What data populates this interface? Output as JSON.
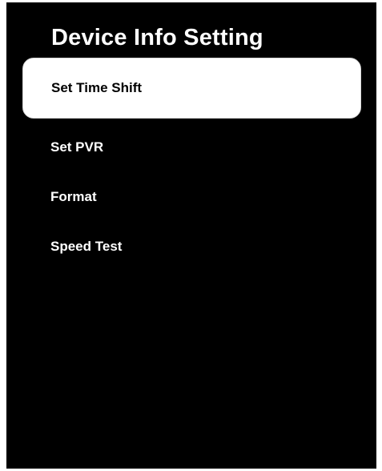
{
  "screen": {
    "title": "Device Info Setting",
    "menu": {
      "items": [
        {
          "label": "Set Time Shift",
          "selected": true
        },
        {
          "label": "Set PVR",
          "selected": false
        },
        {
          "label": "Format",
          "selected": false
        },
        {
          "label": "Speed Test",
          "selected": false
        }
      ]
    }
  },
  "colors": {
    "background": "#000000",
    "text": "#ffffff",
    "selected_background": "#ffffff",
    "selected_text": "#000000"
  }
}
